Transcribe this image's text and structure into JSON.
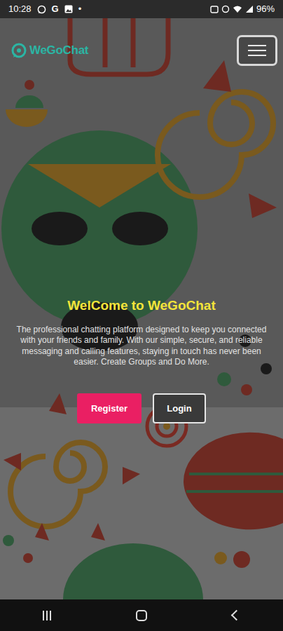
{
  "status_bar": {
    "time": "10:28",
    "notifications": [
      "G"
    ],
    "dot": "•",
    "battery": "96%"
  },
  "header": {
    "logo": "WeGoChat"
  },
  "hero": {
    "title": "WelCome to WeGoChat",
    "description": "The professional chatting platform designed to keep you connected with your friends and family. With our simple, secure, and reliable messaging and calling features, staying in touch has never been easier. Create Groups and Do More."
  },
  "buttons": [
    {
      "label": "Register",
      "kind": "primary"
    },
    {
      "label": "Login",
      "kind": "outline"
    }
  ]
}
